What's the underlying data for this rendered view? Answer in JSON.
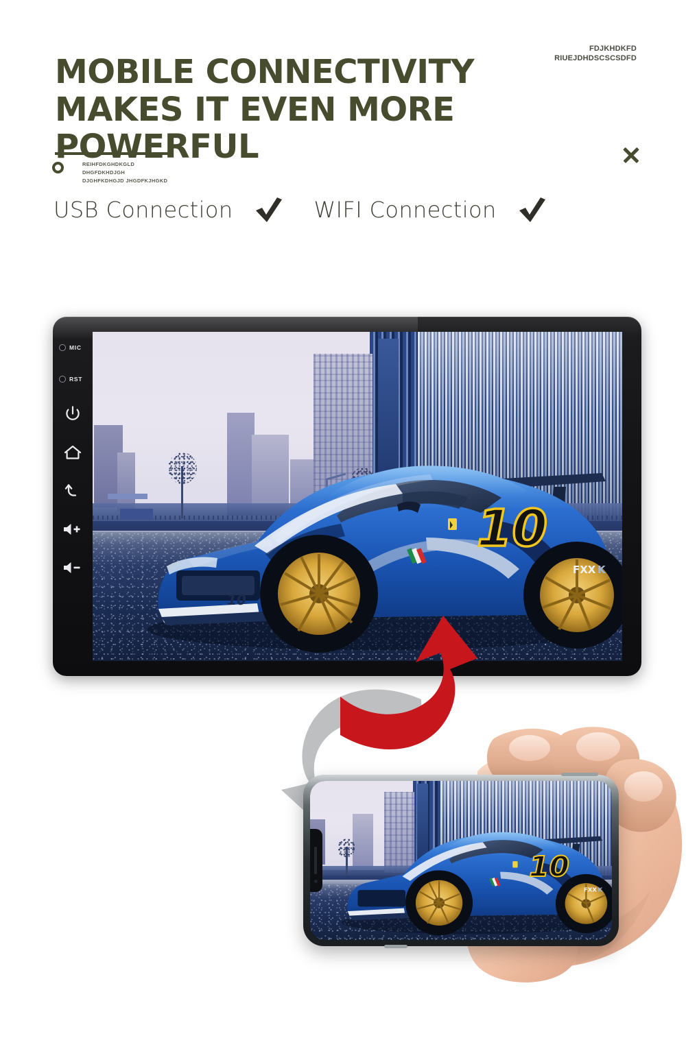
{
  "header": {
    "sku_line1": "FDJKHDKFD",
    "sku_line2": "RIUEJDHDSCSCSDFD",
    "title_line1": "MOBILE CONNECTIVITY",
    "title_line2": "MAKES IT EVEN MORE POWERFUL",
    "subcopy": "REIHFDKGHDKGLD\nDHGFDKHDJGH\nDJGHFKDHGJD JHGDFKJHGKD",
    "close_icon": "close-x-icon",
    "accent_color": "#474c2e"
  },
  "features": [
    {
      "label": "USB Connection",
      "check_icon": "check-mark-icon",
      "checked": true
    },
    {
      "label": "WIFI Connection",
      "check_icon": "check-mark-icon",
      "checked": true
    }
  ],
  "device": {
    "name": "car-head-unit",
    "side_keys": [
      {
        "id": "mic",
        "label": "MIC",
        "icon": "mic-dot-icon"
      },
      {
        "id": "rst",
        "label": "RST",
        "icon": "reset-dot-icon"
      },
      {
        "id": "power",
        "label": "",
        "icon": "power-icon"
      },
      {
        "id": "home",
        "label": "",
        "icon": "home-icon"
      },
      {
        "id": "back",
        "label": "",
        "icon": "back-arrow-icon"
      },
      {
        "id": "volup",
        "label": "",
        "icon": "volume-up-icon"
      },
      {
        "id": "voldown",
        "label": "",
        "icon": "volume-down-icon"
      }
    ],
    "screen_content": {
      "subject": "blue Ferrari FXX K race car",
      "car_number": "10",
      "car_badge": "FXX K",
      "scene": "city street with skyscrapers"
    }
  },
  "transfer": {
    "up_arrow_color": "#c8161d",
    "down_arrow_color": "#b6b8ba",
    "up_arrow_icon": "curved-arrow-up-icon",
    "down_arrow_icon": "curved-arrow-down-icon"
  },
  "phone": {
    "name": "smartphone-in-hand",
    "screen_content": {
      "subject": "blue Ferrari FXX K race car",
      "car_number": "10",
      "car_badge": "FXX K"
    }
  }
}
